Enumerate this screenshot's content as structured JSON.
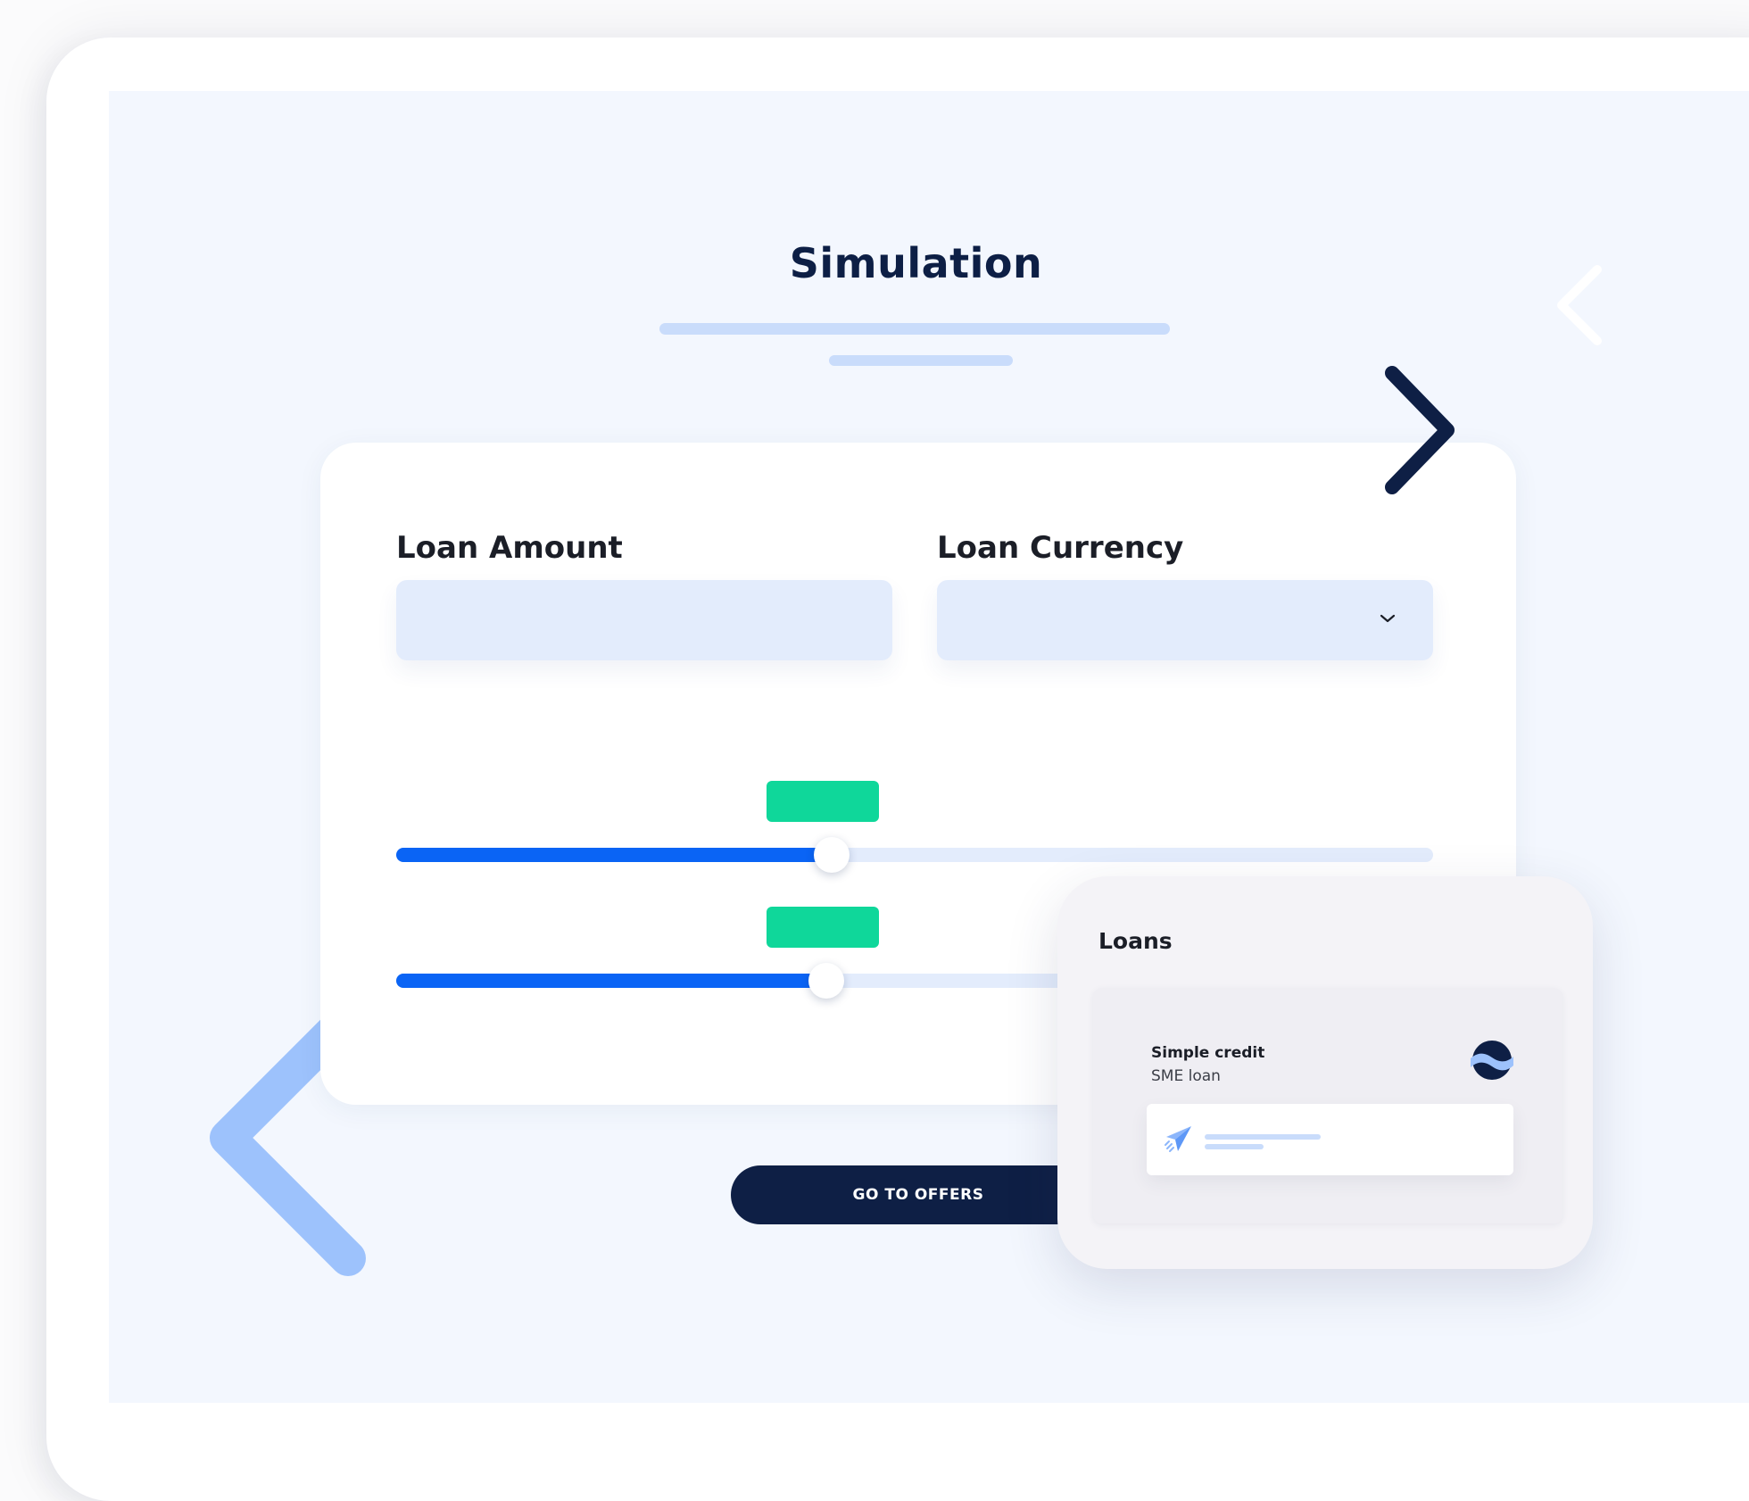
{
  "page": {
    "title": "Simulation"
  },
  "form": {
    "loan_amount_label": "Loan Amount",
    "loan_amount_value": "",
    "loan_currency_label": "Loan Currency",
    "loan_currency_value": "",
    "dropdown_icon": "chevron-down-icon"
  },
  "sliders": [
    {
      "value_percent": 42,
      "badge_color": "#0fd79a"
    },
    {
      "value_percent": 41.5,
      "badge_color": "#0fd79a"
    }
  ],
  "cta": {
    "label": "GO TO OFFERS"
  },
  "loans_panel": {
    "title": "Loans",
    "items": [
      {
        "name": "Simple credit",
        "type": "SME loan",
        "logo_icon": "brand-logo-icon",
        "action_icon": "paper-plane-icon"
      }
    ]
  },
  "colors": {
    "primary_dark": "#0e1f45",
    "accent_blue": "#0a64f5",
    "accent_green": "#0fd79a",
    "input_background": "#e3ecfc",
    "page_background": "#f3f7fe"
  }
}
